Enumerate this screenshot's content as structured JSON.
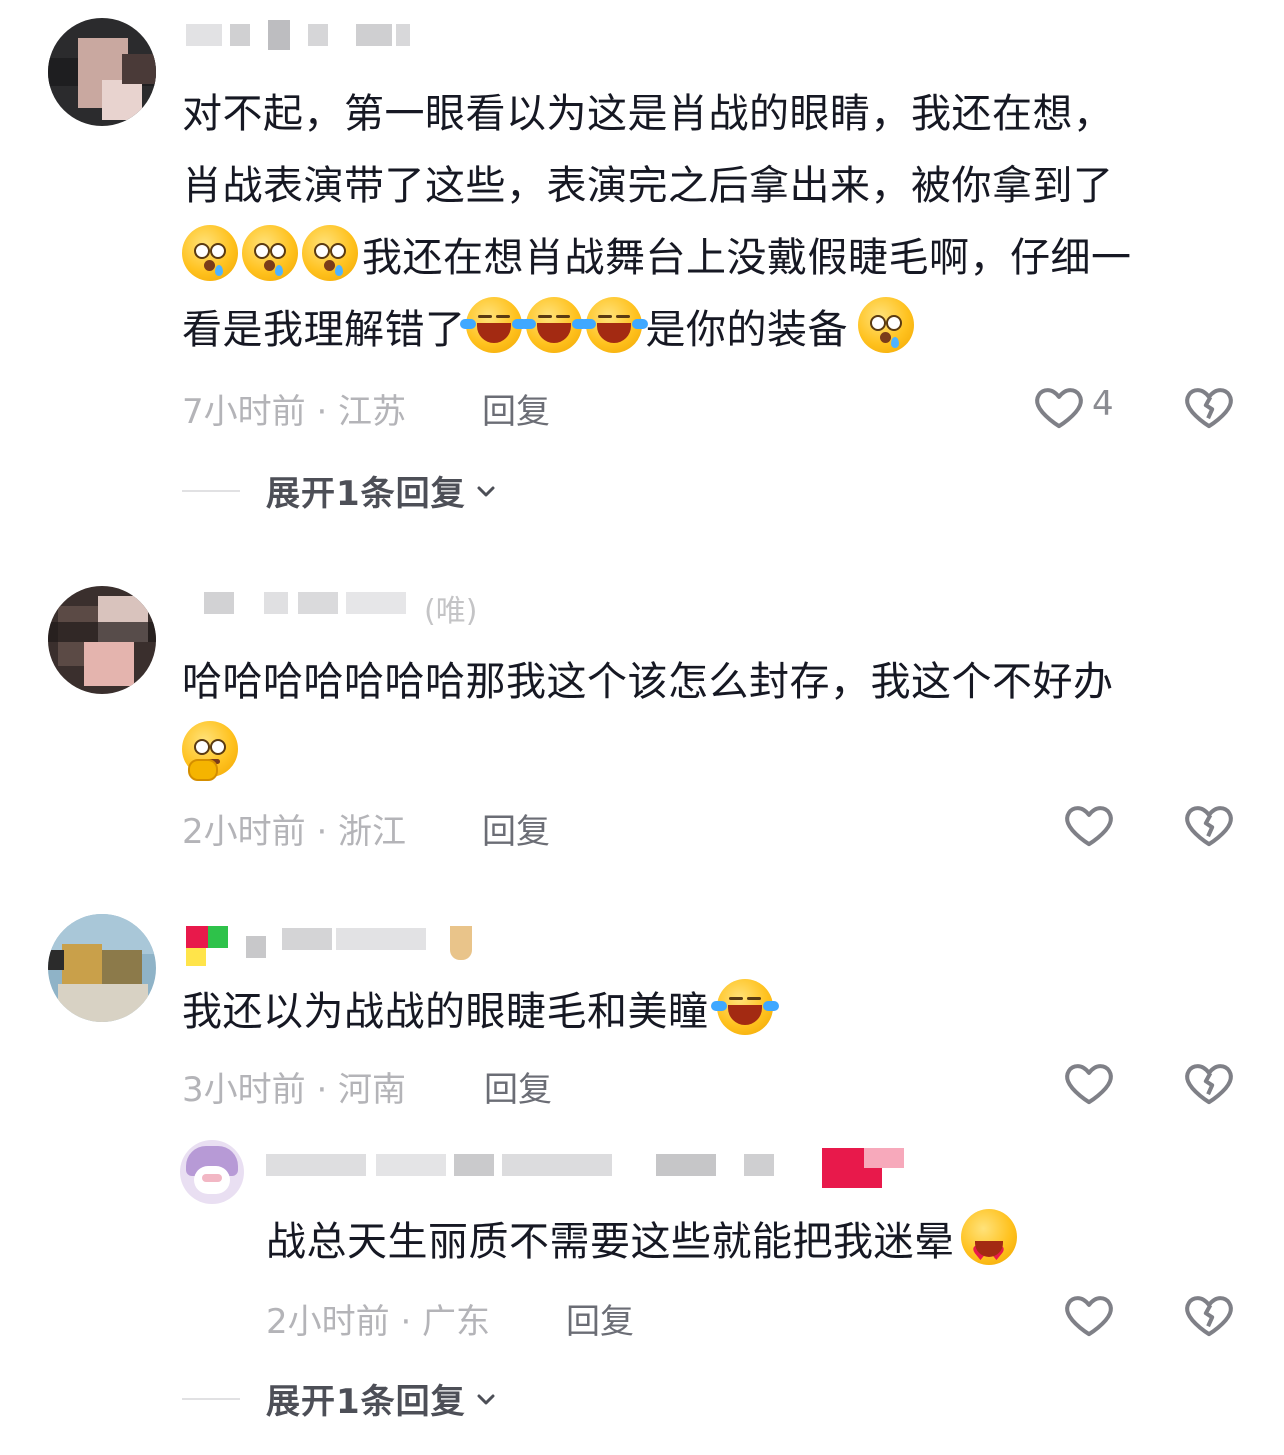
{
  "comments": [
    {
      "text_lines": [
        "对不起，第一眼看以为这是肖战的眼睛，我还在想，",
        "肖战表演带了这些，表演完之后拿出来，被你拿到了",
        "我还在想肖战舞台上没戴假睫毛啊，仔细一",
        "看是我理解错了",
        "是你的装备"
      ],
      "meta": "7小时前 · 江苏",
      "reply_label": "回复",
      "like_count": "4",
      "expand_label": "展开1条回复"
    },
    {
      "username": "(唯)",
      "text_lines": [
        "哈哈哈哈哈哈哈那我这个该怎么封存，我这个不好办"
      ],
      "meta": "2小时前 · 浙江",
      "reply_label": "回复"
    },
    {
      "text_lines": [
        "我还以为战战的眼睫毛和美瞳"
      ],
      "meta": "3小时前 · 河南",
      "reply_label": "回复",
      "replies": [
        {
          "text_lines": [
            "战总天生丽质不需要这些就能把我迷晕"
          ],
          "meta": "2小时前 · 广东",
          "reply_label": "回复"
        }
      ],
      "expand_label": "展开1条回复"
    }
  ],
  "icons": {
    "like": "heart-outline-icon",
    "dislike": "broken-heart-icon",
    "expand": "chevron-down-icon",
    "emoji_shocked": "shocked-crying-emoji",
    "emoji_laugh": "laughing-crying-emoji",
    "emoji_think": "thinking-emoji",
    "emoji_love": "heart-eyes-emoji"
  },
  "colors": {
    "text": "#161823",
    "meta": "#b4b4b8",
    "reply": "#6b6d75",
    "icon": "#7f8087"
  }
}
